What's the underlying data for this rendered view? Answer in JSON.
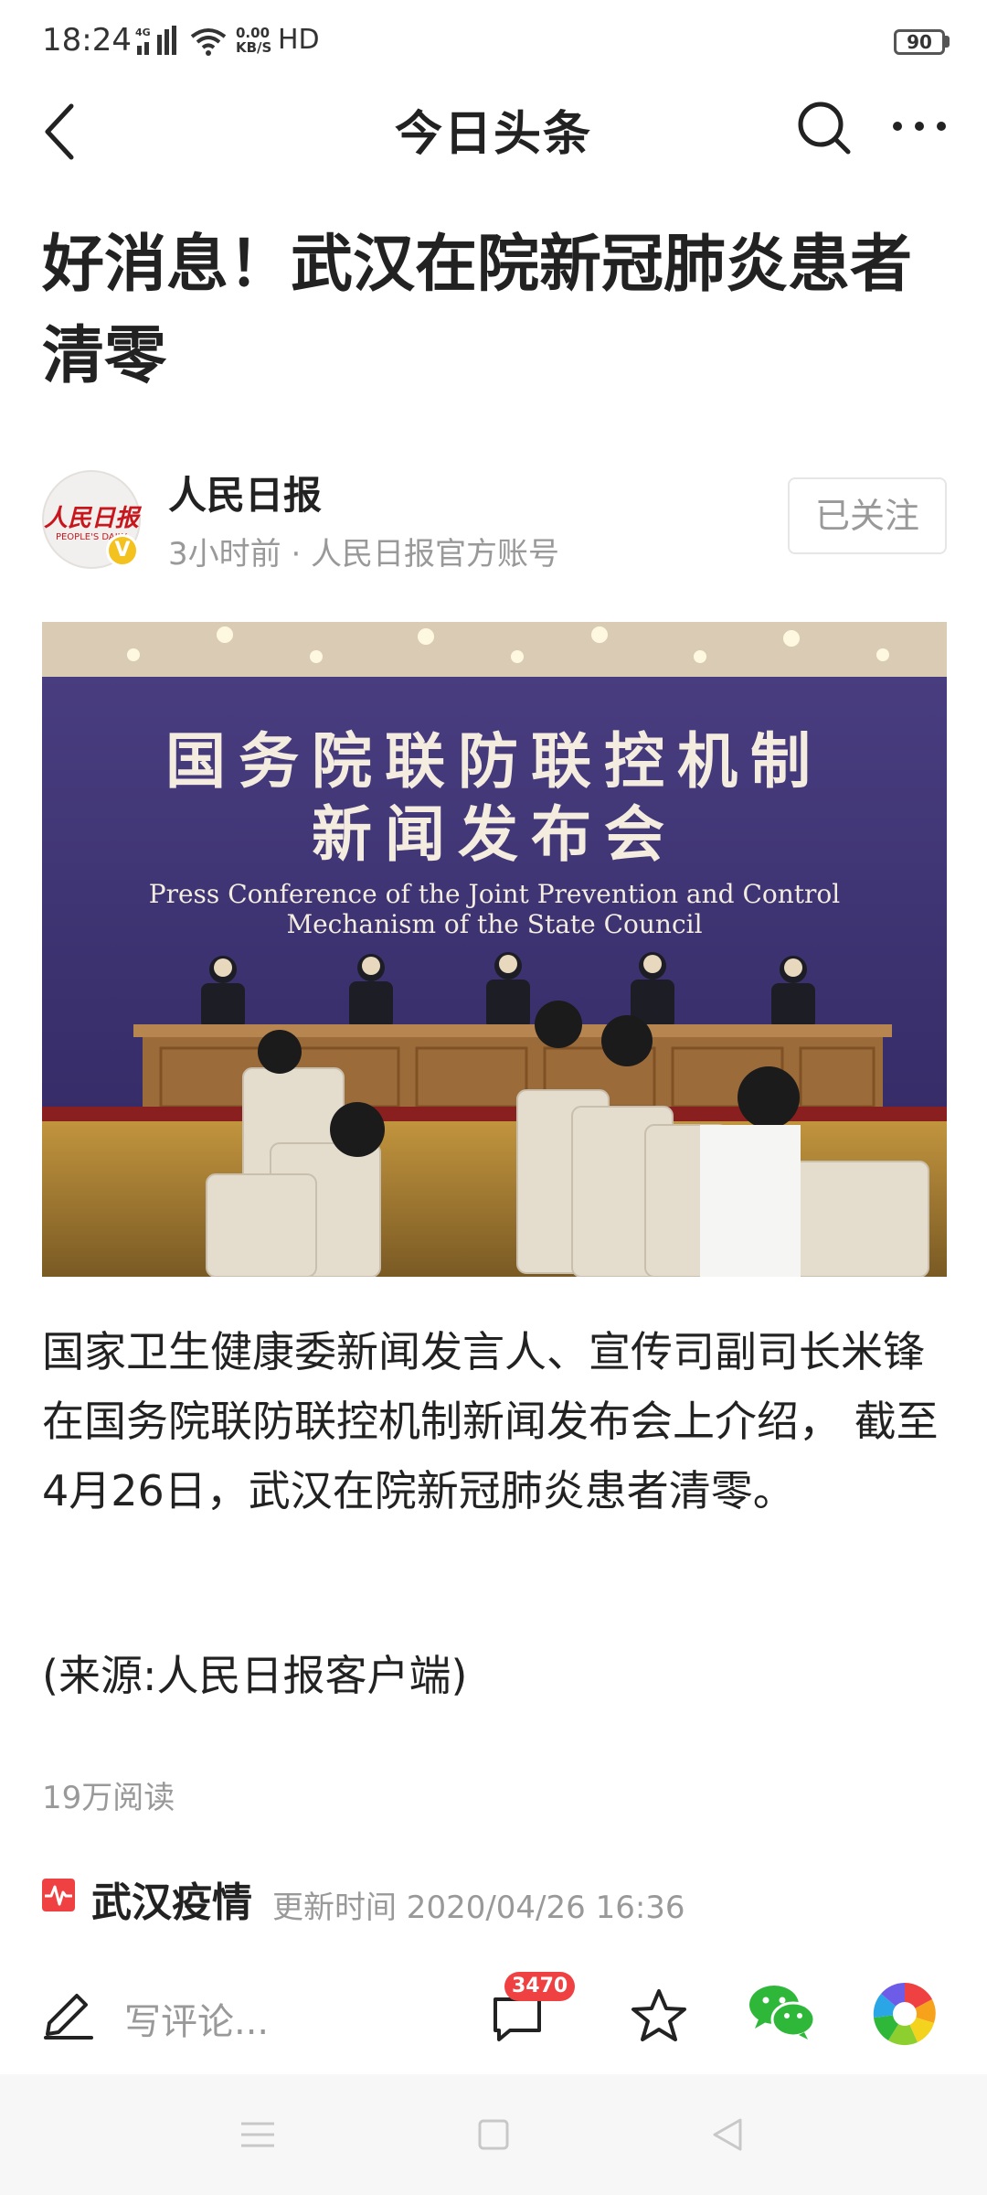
{
  "status_bar": {
    "time": "18:24",
    "network": "4G",
    "speed_value": "0.00",
    "speed_unit": "KB/S",
    "hd": "HD",
    "battery": "90"
  },
  "nav": {
    "title": "今日头条",
    "icons": [
      "back-icon",
      "search-icon",
      "more-icon"
    ]
  },
  "article": {
    "title": "好消息！武汉在院新冠肺炎患者清零",
    "author": {
      "name": "人民日报",
      "meta": "3小时前 · 人民日报官方账号",
      "follow_label": "已关注",
      "avatar_logo_text": "人民日报",
      "avatar_logo_sub": "PEOPLE'S DAILY",
      "verified_mark": "V"
    },
    "photo": {
      "banner_line1": "国务院联防联控机制",
      "banner_line2": "新闻发布会",
      "banner_en1": "Press Conference of the Joint Prevention and Control",
      "banner_en2": "Mechanism of the State Council"
    },
    "body": "国家卫生健康委新闻发言人、宣传司副司长米锋在国务院联防联控机制新闻发布会上介绍， 截至4月26日，武汉在院新冠肺炎患者清零。",
    "source": "(来源:人民日报客户端)",
    "read_count": "19万阅读"
  },
  "topic": {
    "name": "武汉疫情",
    "update": "更新时间 2020/04/26 16:36"
  },
  "action_bar": {
    "comment_placeholder": "写评论...",
    "comment_count": "3470",
    "icons": [
      "edit-icon",
      "comment-icon",
      "star-icon",
      "wechat-icon",
      "moments-icon"
    ]
  },
  "colors": {
    "accent_red": "#f04142",
    "verified_yellow": "#f4c21f",
    "wechat_green": "#2fb73a",
    "banner_purple": "#3e3272"
  }
}
